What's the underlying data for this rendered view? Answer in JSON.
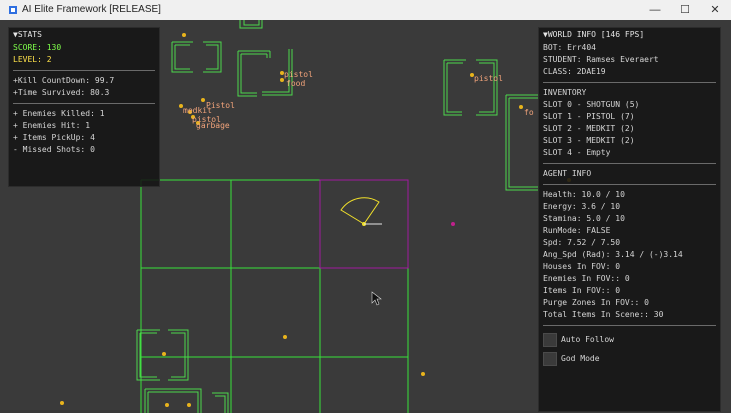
{
  "window": {
    "title": "AI Elite Framework [RELEASE]",
    "controls": [
      "—",
      "☐",
      "✕"
    ]
  },
  "stats": {
    "header": "▼STATS",
    "score": "SCORE: 130",
    "level": "LEVEL: 2",
    "kill_countdown": "+Kill CountDown: 99.7",
    "time_survived": "+Time Survived: 80.3",
    "enemies_killed": "+ Enemies Killed: 1",
    "enemies_hit": "+ Enemies Hit: 1",
    "items_pickup": "+ Items PickUp: 4",
    "missed_shots": "- Missed Shots: 0"
  },
  "world_info": {
    "header": "▼WORLD INFO [146 FPS]",
    "bot": "BOT: Err404",
    "student": "STUDENT: Ramses Everaert",
    "class": "CLASS: 2DAE19",
    "inventory_title": "INVENTORY",
    "slots": [
      "SLOT 0 - SHOTGUN (5)",
      "SLOT 1 - PISTOL (7)",
      "SLOT 2 - MEDKIT (2)",
      "SLOT 3 - MEDKIT (2)",
      "SLOT 4 - Empty"
    ],
    "agent_title": "AGENT INFO",
    "agent": [
      "Health: 10.0 / 10",
      "Energy: 3.6 / 10",
      "Stamina: 5.0 / 10",
      "RunMode: FALSE",
      "Spd: 7.52 / 7.50",
      "Ang_Spd (Rad): 3.14 / (-)3.14",
      "Houses In FOV: 0",
      "Enemies In FOV:: 0",
      "Items In FOV:: 0",
      "Purge Zones In FOV:: 0",
      "Total Items In Scene:: 30"
    ],
    "auto_follow": "Auto Follow",
    "god_mode": "God Mode"
  },
  "scene_labels": {
    "pistol_a": "pistol",
    "pistol_b": "Pistol",
    "pistol_c": "pistol",
    "pistol_d": "pistol",
    "medkit": "medkit",
    "garbage": "garbage",
    "fo": "fo",
    "food": "food"
  },
  "colors": {
    "house": "#4cd84c",
    "grid": "#38e23a",
    "fov_square": "#a01a9e",
    "fov_cone": "#f2e12a",
    "item_dot": "#e8b41c",
    "item_label": "#f3a47b"
  }
}
